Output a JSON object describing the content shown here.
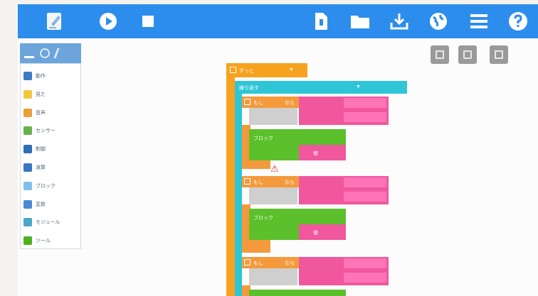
{
  "toolbar": {
    "icons": [
      "edit-icon",
      "play-icon",
      "stop-icon",
      "file-icon",
      "folder-icon",
      "download-icon",
      "globe-icon",
      "menu-icon",
      "help-icon"
    ]
  },
  "categories": [
    {
      "label": "動作",
      "icon": "move-icon",
      "color": "#3e7ac7"
    },
    {
      "label": "見た",
      "icon": "look-icon",
      "color": "#f4c542"
    },
    {
      "label": "音声",
      "icon": "sound-icon",
      "color": "#e6a23c"
    },
    {
      "label": "センサー",
      "icon": "sensor-icon",
      "color": "#66b24a"
    },
    {
      "label": "制御",
      "icon": "control-icon",
      "color": "#2e6fb8"
    },
    {
      "label": "演算",
      "icon": "operator-icon",
      "color": "#3a77c2"
    },
    {
      "label": "ブロック",
      "icon": "block-icon",
      "color": "#7ec1e8"
    },
    {
      "label": "変数",
      "icon": "variable-icon",
      "color": "#4a8ad0"
    },
    {
      "label": "モジュール",
      "icon": "module-icon",
      "color": "#4aa8c8"
    },
    {
      "label": "ツール",
      "icon": "tool-icon",
      "color": "#4fb01e"
    }
  ],
  "blocks": {
    "hat_label": "ずっと",
    "loop_label": "繰り返す",
    "if_label": "もし",
    "then_label": "なら",
    "action_label": "ブロック",
    "value_label": "値"
  },
  "colors": {
    "toolbar": "#2d8ded",
    "orange": "#f7a21f",
    "teal": "#2ec6d6",
    "pink": "#f0579d",
    "green": "#5bc02b"
  }
}
